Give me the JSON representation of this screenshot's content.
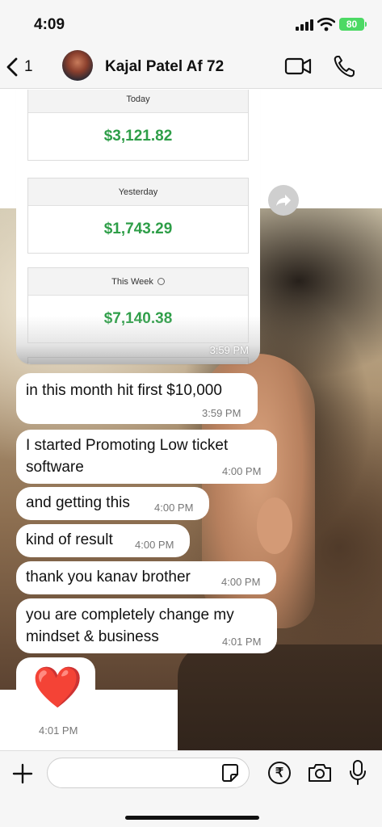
{
  "status": {
    "time": "4:09",
    "battery": "80"
  },
  "header": {
    "back_count": "1",
    "contact_name": "Kajal Patel Af 72"
  },
  "shared_image": {
    "stats": [
      {
        "label": "Today",
        "value": "$3,121.82"
      },
      {
        "label": "Yesterday",
        "value": "$1,743.29"
      },
      {
        "label": "This Week",
        "value": "$7,140.38"
      }
    ],
    "time": "3:59 PM"
  },
  "messages": [
    {
      "text": "in this month hit first $10,000",
      "time": "3:59 PM"
    },
    {
      "text": "I started Promoting Low ticket software",
      "time": "4:00 PM"
    },
    {
      "text": "and getting this",
      "time": "4:00 PM"
    },
    {
      "text": "kind of result",
      "time": "4:00 PM"
    },
    {
      "text": "thank you kanav brother",
      "time": "4:00 PM"
    },
    {
      "text": "you are completely change my mindset & business",
      "time": "4:01 PM"
    }
  ],
  "heart_message": {
    "emoji": "❤️",
    "time": "4:01 PM"
  },
  "composer": {
    "placeholder": "",
    "currency_symbol": "₹"
  }
}
